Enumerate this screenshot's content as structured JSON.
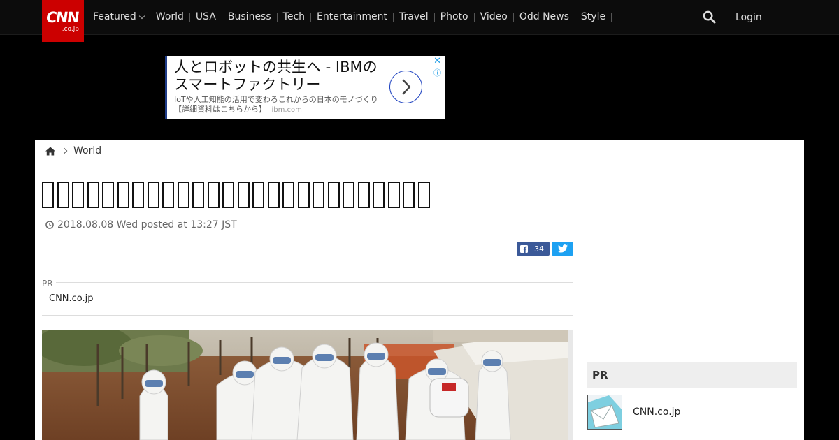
{
  "brand": {
    "logo_main": "CNN",
    "logo_sub": ".co.jp",
    "accent": "#cc0000"
  },
  "nav": {
    "items": [
      {
        "label": "Featured",
        "has_dropdown": true
      },
      {
        "label": "World"
      },
      {
        "label": "USA"
      },
      {
        "label": "Business"
      },
      {
        "label": "Tech"
      },
      {
        "label": "Entertainment"
      },
      {
        "label": "Travel"
      },
      {
        "label": "Photo"
      },
      {
        "label": "Video"
      },
      {
        "label": "Odd News"
      },
      {
        "label": "Style"
      }
    ],
    "login_label": "Login",
    "search_icon": "search-icon"
  },
  "ad": {
    "headline": "人とロボットの共生へ - IBMのスマートファクトリー",
    "subtext": "IoTや人工知能の活用で変わるこれからの日本のモノづくり【詳細資料はこちらから】",
    "domain": "ibm.com",
    "close_icon": "close-icon",
    "info_icon": "info-icon"
  },
  "breadcrumb": {
    "home_icon": "home-icon",
    "section": "World"
  },
  "article": {
    "title_glyph_count": 26,
    "date": "2018.08.08 Wed posted at 13:27 JST",
    "share": {
      "facebook_count": "34"
    }
  },
  "pr_block": {
    "label": "PR",
    "link": "CNN.co.jp"
  },
  "sidebar": {
    "pr_title": "PR",
    "pr_item": "CNN.co.jp"
  }
}
